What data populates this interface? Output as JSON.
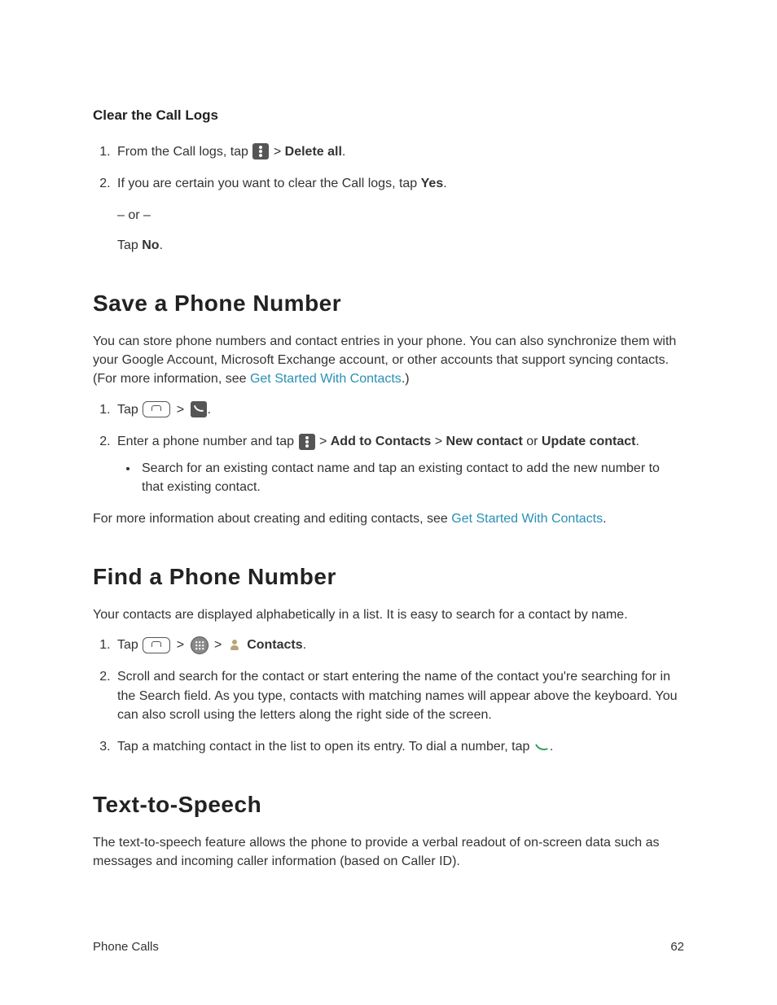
{
  "clear_logs": {
    "heading": "Clear the Call Logs",
    "step1_a": "From the Call logs, tap ",
    "step1_b": " > ",
    "step1_c": "Delete all",
    "step1_d": ".",
    "step2_a": "If you are certain you want to clear the Call logs, tap ",
    "step2_b": "Yes",
    "step2_c": ".",
    "or": "– or –",
    "tapno_a": "Tap ",
    "tapno_b": "No",
    "tapno_c": "."
  },
  "save_number": {
    "heading": "Save a Phone Number",
    "intro_a": "You can store phone numbers and contact entries in your phone. You can also synchronize them with your Google Account, Microsoft Exchange account, or other accounts that support syncing contacts. (For more information, see ",
    "intro_link": "Get Started With Contacts",
    "intro_b": ".)",
    "step1_a": "Tap ",
    "step1_b": " > ",
    "step1_c": ".",
    "step2_a": "Enter a phone number and tap ",
    "step2_b": " > ",
    "step2_c": "Add to Contacts",
    "step2_d": " > ",
    "step2_e": "New contact",
    "step2_f": " or ",
    "step2_g": "Update contact",
    "step2_h": ".",
    "bullet": "Search for an existing contact name and tap an existing contact to add the new number to that existing contact.",
    "outro_a": "For more information about creating and editing contacts, see ",
    "outro_link": "Get Started With Contacts",
    "outro_b": "."
  },
  "find_number": {
    "heading": "Find a Phone Number",
    "intro": "Your contacts are displayed alphabetically in a list. It is easy to search for a contact by name.",
    "step1_a": "Tap ",
    "step1_gt1": " > ",
    "step1_gt2": " > ",
    "step1_b": " ",
    "step1_c": "Contacts",
    "step1_d": ".",
    "step2": "Scroll and search for the contact or start entering the name of the contact you're searching for in the Search field. As you type, contacts with matching names will appear above the keyboard. You can also scroll using the letters along the right side of the screen.",
    "step3_a": "Tap a matching contact in the list to open its entry. To dial a number, tap ",
    "step3_b": "."
  },
  "tts": {
    "heading": "Text-to-Speech",
    "body": "The text-to-speech feature allows the phone to provide a verbal readout of on-screen data such as messages and incoming caller information (based on Caller ID)."
  },
  "footer": {
    "section": "Phone Calls",
    "page": "62"
  }
}
